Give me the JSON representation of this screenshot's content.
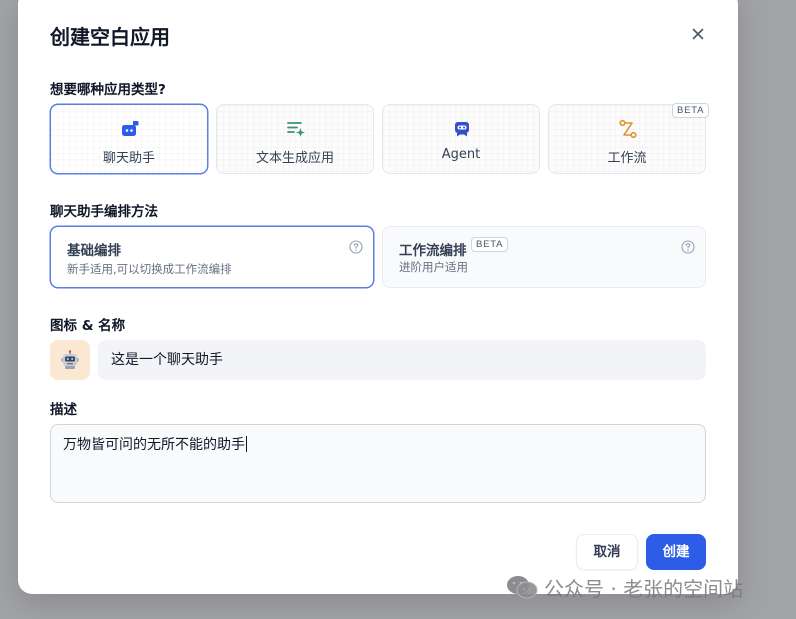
{
  "dialog": {
    "title": "创建空白应用"
  },
  "app_type": {
    "label": "想要哪种应用类型?",
    "options": [
      {
        "label": "聊天助手",
        "icon": "chat-bot-icon",
        "selected": true
      },
      {
        "label": "文本生成应用",
        "icon": "text-generate-icon",
        "selected": false
      },
      {
        "label": "Agent",
        "icon": "robot-icon",
        "selected": false
      },
      {
        "label": "工作流",
        "icon": "workflow-icon",
        "selected": false,
        "badge": "BETA"
      }
    ]
  },
  "orchestration": {
    "label": "聊天助手编排方法",
    "options": [
      {
        "title": "基础编排",
        "desc": "新手适用,可以切换成工作流编排",
        "selected": true
      },
      {
        "title": "工作流编排",
        "badge": "BETA",
        "desc": "进阶用户适用",
        "selected": false
      }
    ]
  },
  "identity": {
    "label": "图标 & 名称",
    "avatar_icon": "robot-emoji-icon",
    "name_value": "这是一个聊天助手"
  },
  "description": {
    "label": "描述",
    "value": "万物皆可问的无所不能的助手"
  },
  "footer": {
    "cancel_label": "取消",
    "create_label": "创建"
  },
  "watermark": {
    "text": "公众号 · 老张的空间站"
  },
  "colors": {
    "primary": "#2d5de6",
    "selected_border": "#5b7fe6",
    "avatar_bg": "#fbe8d3",
    "overlay": "#a2a3a7"
  }
}
